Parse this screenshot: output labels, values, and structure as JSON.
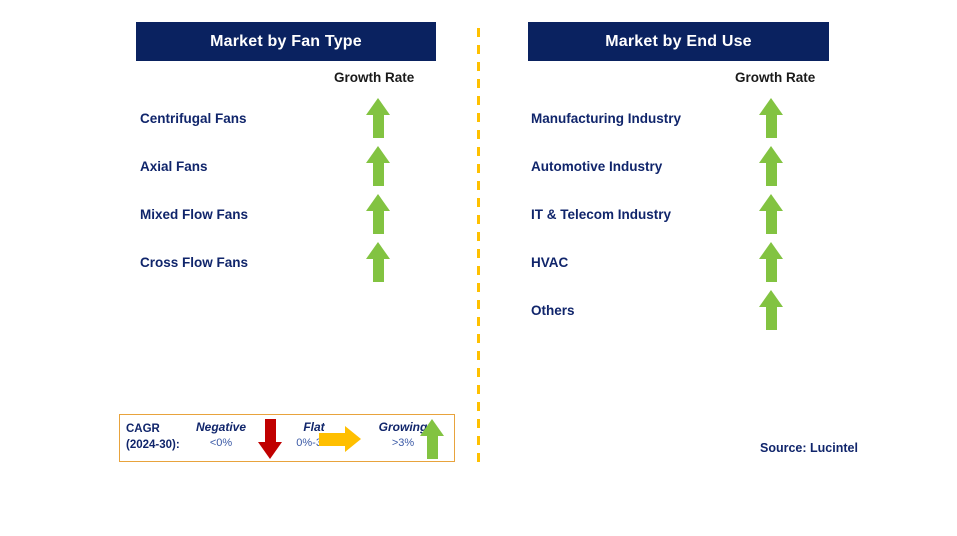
{
  "colors": {
    "header_bg": "#0a2260",
    "header_text": "#ffffff",
    "label_text": "#10256b",
    "growing_arrow": "#82c341",
    "negative_arrow": "#c00000",
    "flat_arrow": "#ffbf00",
    "divider": "#ffc000",
    "legend_border": "#e8a33d",
    "legend_value_text": "#3b5aa6"
  },
  "panels": [
    {
      "title": "Market by Fan Type",
      "column_header": "Growth Rate",
      "rows": [
        {
          "label": "Centrifugal Fans",
          "growth": "growing",
          "icon": "arrow-up-icon"
        },
        {
          "label": "Axial Fans",
          "growth": "growing",
          "icon": "arrow-up-icon"
        },
        {
          "label": "Mixed Flow Fans",
          "growth": "growing",
          "icon": "arrow-up-icon"
        },
        {
          "label": "Cross Flow Fans",
          "growth": "growing",
          "icon": "arrow-up-icon"
        }
      ]
    },
    {
      "title": "Market by End Use",
      "column_header": "Growth Rate",
      "rows": [
        {
          "label": "Manufacturing Industry",
          "growth": "growing",
          "icon": "arrow-up-icon"
        },
        {
          "label": "Automotive Industry",
          "growth": "growing",
          "icon": "arrow-up-icon"
        },
        {
          "label": "IT & Telecom Industry",
          "growth": "growing",
          "icon": "arrow-up-icon"
        },
        {
          "label": "HVAC",
          "growth": "growing",
          "icon": "arrow-up-icon"
        },
        {
          "label": "Others",
          "growth": "growing",
          "icon": "arrow-up-icon"
        }
      ]
    }
  ],
  "legend": {
    "cagr_line1": "CAGR",
    "cagr_line2": "(2024-30):",
    "items": [
      {
        "word": "Negative",
        "value": "<0%",
        "icon": "arrow-down-icon"
      },
      {
        "word": "Flat",
        "value": "0%-3%",
        "icon": "arrow-right-icon"
      },
      {
        "word": "Growing",
        "value": ">3%",
        "icon": "arrow-up-icon"
      }
    ]
  },
  "source": "Source: Lucintel"
}
